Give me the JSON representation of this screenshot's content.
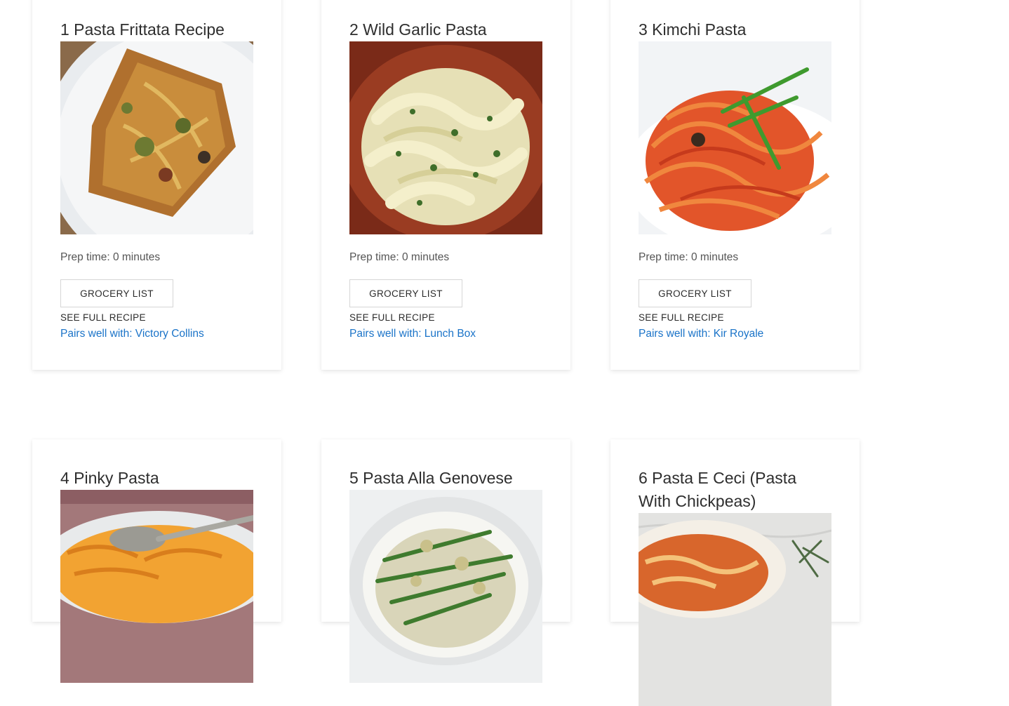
{
  "recipes": [
    {
      "title": "1 Pasta Frittata Recipe",
      "prep": "Prep time: 0 minutes",
      "grocery_label": "GROCERY LIST",
      "full_recipe_label": "SEE FULL RECIPE",
      "pairs": "Pairs well with: Victory Collins",
      "image_icon": "frittata-photo"
    },
    {
      "title": "2 Wild Garlic Pasta",
      "prep": "Prep time: 0 minutes",
      "grocery_label": "GROCERY LIST",
      "full_recipe_label": "SEE FULL RECIPE",
      "pairs": "Pairs well with: Lunch Box",
      "image_icon": "garlic-pasta-photo"
    },
    {
      "title": "3 Kimchi Pasta",
      "prep": "Prep time: 0 minutes",
      "grocery_label": "GROCERY LIST",
      "full_recipe_label": "SEE FULL RECIPE",
      "pairs": "Pairs well with: Kir Royale",
      "image_icon": "kimchi-pasta-photo"
    },
    {
      "title": "4 Pinky Pasta",
      "image_icon": "pinky-pasta-photo"
    },
    {
      "title": "5 Pasta Alla Genovese",
      "image_icon": "genovese-photo"
    },
    {
      "title": "6 Pasta E Ceci (Pasta With Chickpeas)",
      "image_icon": "pasta-ceci-photo"
    }
  ],
  "colors": {
    "link": "#1a73c8",
    "text": "#333333",
    "border": "#d6d6d6"
  }
}
